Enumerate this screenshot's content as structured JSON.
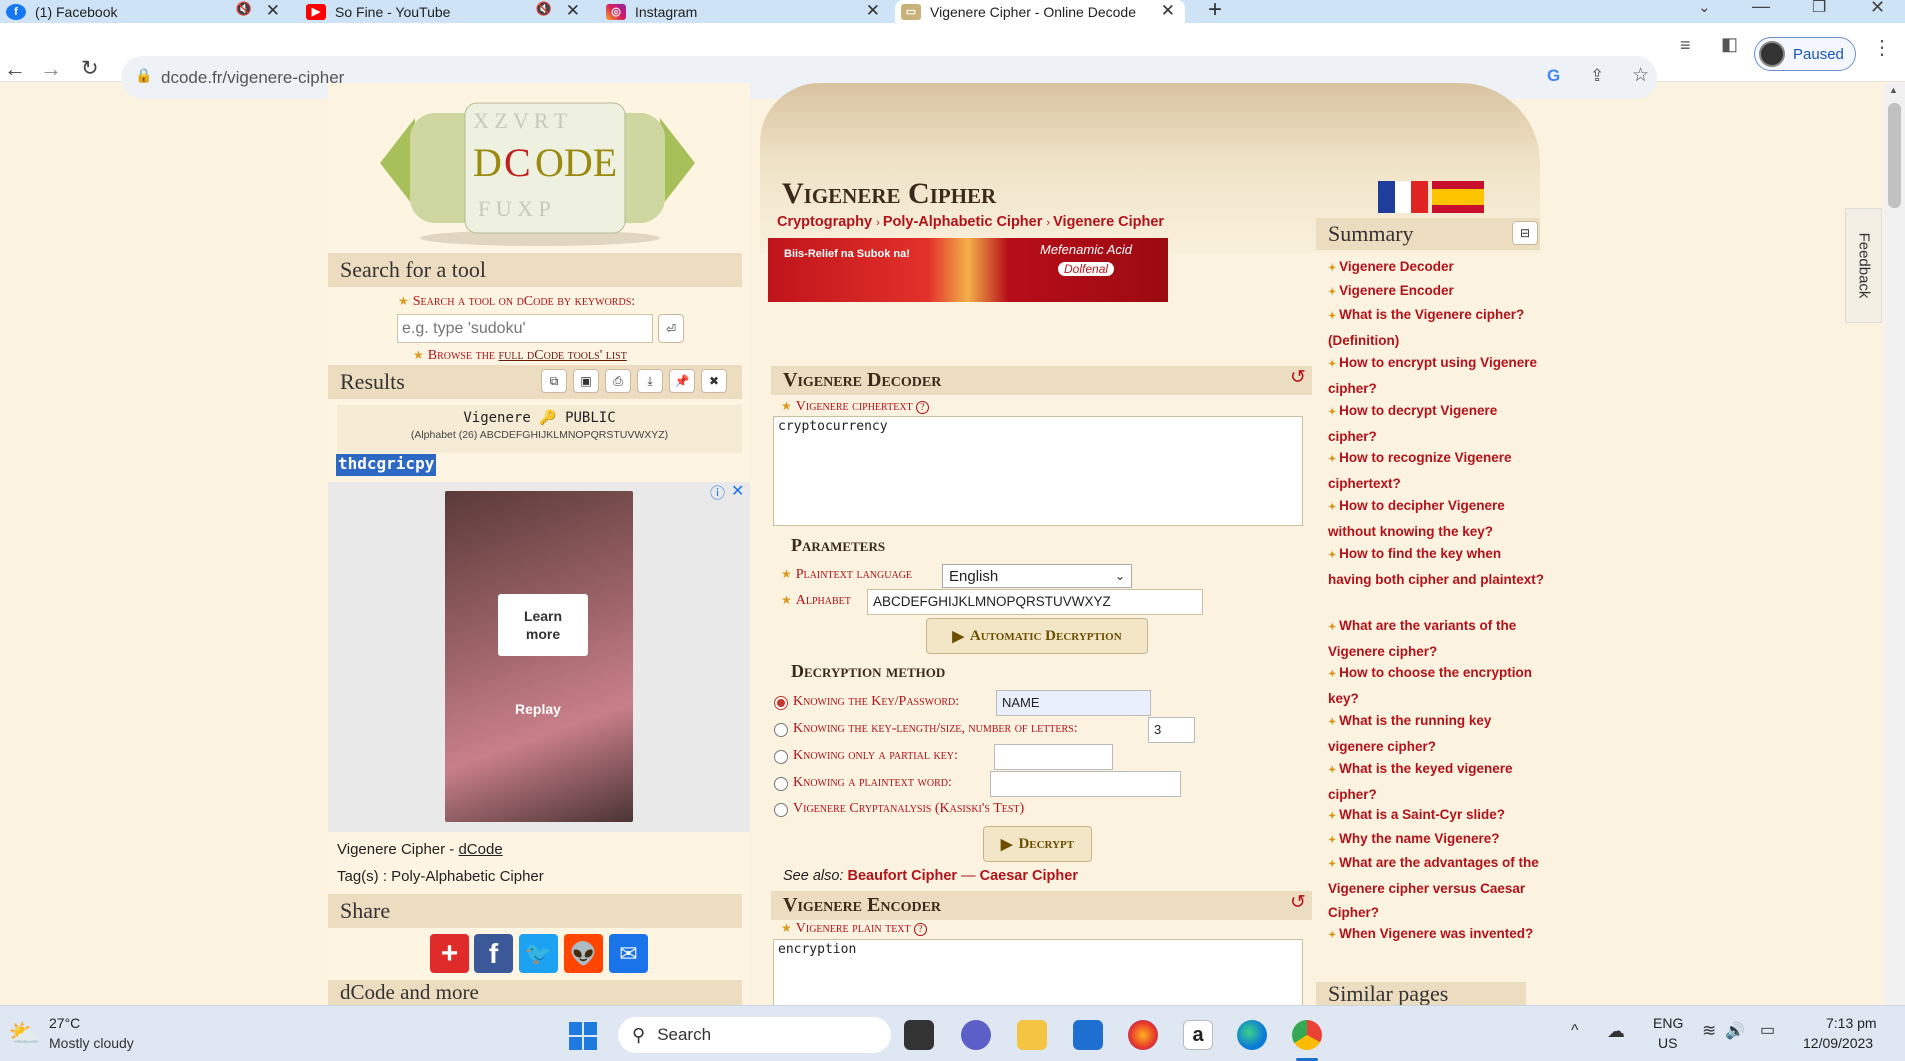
{
  "browser": {
    "tabs": [
      {
        "label": "(1) Facebook"
      },
      {
        "label": "So Fine - YouTube"
      },
      {
        "label": "Instagram"
      },
      {
        "label": "Vigenere Cipher - Online Decode"
      }
    ],
    "url": "dcode.fr/vigenere-cipher",
    "profile_status": "Paused"
  },
  "left": {
    "search_title": "Search for a tool",
    "search_hint": "Search a tool on dCode by keywords:",
    "search_placeholder": "e.g. type 'sudoku'",
    "browse_prefix": "Browse the ",
    "browse_link": "full dCode tools' list",
    "results_title": "Results",
    "result_line": "Vigenere 🔑 PUBLIC",
    "result_alphabet": "(Alphabet (26) ABCDEFGHIJKLMNOPQRSTUVWXYZ)",
    "result_output": "thdcgricpy",
    "ad_cta": "Learn more",
    "ad_replay": "Replay",
    "tool_line_prefix": "Vigenere Cipher - ",
    "tool_line_link": "dCode",
    "tags_line": "Tag(s) : Poly-Alphabetic Cipher",
    "share_title": "Share",
    "more_title": "dCode and more"
  },
  "main": {
    "page_title": "Vigenere Cipher",
    "breadcrumb": [
      "Cryptography",
      "Poly-Alphabetic Cipher",
      "Vigenere Cipher"
    ],
    "ad_text_1": "Biis-Relief na Subok na!",
    "ad_text_2": "Mefenamic Acid",
    "ad_text_3": "Dolfenal",
    "decoder": {
      "title": "Vigenere Decoder",
      "ciphertext_label": "Vigenere ciphertext",
      "ciphertext_value": "cryptocurrency",
      "params_title": "Parameters",
      "lang_label": "Plaintext language",
      "lang_value": "English",
      "alphabet_label": "Alphabet",
      "alphabet_value": "ABCDEFGHIJKLMNOPQRSTUVWXYZ",
      "auto_btn": "Automatic Decryption",
      "method_title": "Decryption method",
      "methods": [
        {
          "label": "Knowing the Key/Password:",
          "value": "NAME"
        },
        {
          "label": "Knowing the key-length/size, number of letters:",
          "value": "3"
        },
        {
          "label": "Knowing only a partial key:",
          "value": ""
        },
        {
          "label": "Knowing a plaintext word:",
          "value": ""
        },
        {
          "label": "Vigenere Cryptanalysis (Kasiski's Test)",
          "value": ""
        }
      ],
      "decrypt_btn": "Decrypt",
      "see_also": "See also:",
      "see_also_1": "Beaufort Cipher",
      "see_also_sep": " — ",
      "see_also_2": "Caesar Cipher"
    },
    "encoder": {
      "title": "Vigenere Encoder",
      "plain_label": "Vigenere plain text",
      "plain_value": "encryption"
    }
  },
  "summary": {
    "title": "Summary",
    "items": [
      "Vigenere Decoder",
      "Vigenere Encoder",
      "What is the Vigenere cipher? (Definition)",
      "How to encrypt using Vigenere cipher?",
      "How to decrypt Vigenere cipher?",
      "How to recognize Vigenere ciphertext?",
      "How to decipher Vigenere without knowing the key?",
      "How to find the key when having both cipher and plaintext?",
      "What are the variants of the Vigenere cipher?",
      "How to choose the encryption key?",
      "What is the running key vigenere cipher?",
      "What is the keyed vigenere cipher?",
      "What is a Saint-Cyr slide?",
      "Why the name Vigenere?",
      "What are the advantages of the Vigenere cipher versus Caesar Cipher?",
      "When Vigenere was invented?"
    ],
    "similar_title": "Similar pages",
    "feedback": "Feedback"
  },
  "taskbar": {
    "temp": "27°C",
    "weather": "Mostly cloudy",
    "search": "Search",
    "lang1": "ENG",
    "lang2": "US",
    "time": "7:13 pm",
    "date": "12/09/2023"
  }
}
